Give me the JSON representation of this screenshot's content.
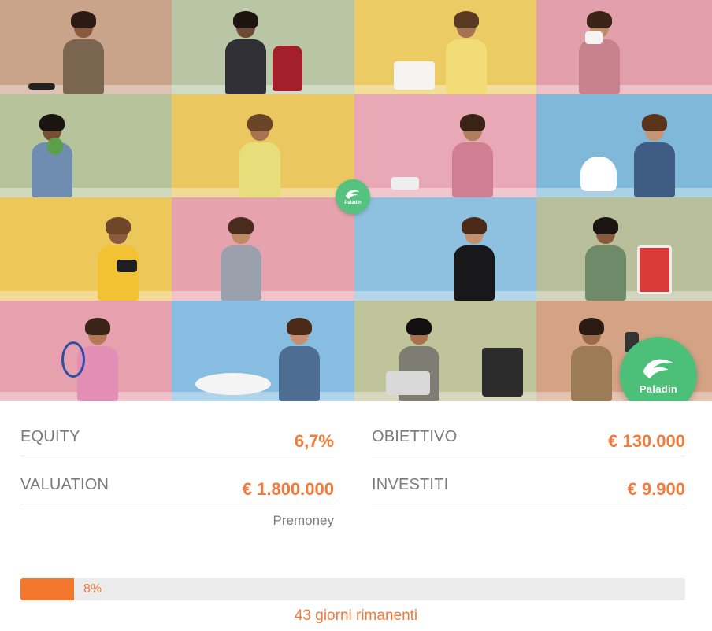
{
  "brand": {
    "badge_label": "Paladin",
    "badge_small_label": "Paladin",
    "accent_color": "#f27a3a",
    "brand_color": "#4cbf79"
  },
  "collage": {
    "tiles": [
      {
        "bg": "#c9a48b",
        "shirt": "#7a6650",
        "prop": "vr-headset"
      },
      {
        "bg": "#b9c6a6",
        "shirt": "#2f2f35",
        "prop": "stand-mixer"
      },
      {
        "bg": "#eccb65",
        "shirt": "#f1dc78",
        "prop": "sewing-machine"
      },
      {
        "bg": "#e2a0ac",
        "shirt": "#c7828d",
        "prop": "instant-camera"
      },
      {
        "bg": "#b7c49b",
        "shirt": "#6f8db0",
        "prop": "gadget"
      },
      {
        "bg": "#eac75f",
        "shirt": "#e7dd7a",
        "prop": "dance"
      },
      {
        "bg": "#e8a8b6",
        "shirt": "#d07f92",
        "prop": "projector"
      },
      {
        "bg": "#7fb8d8",
        "shirt": "#3f5d84",
        "prop": "smart-garden"
      },
      {
        "bg": "#ecc759",
        "shirt": "#f2c234",
        "prop": "bag"
      },
      {
        "bg": "#e6a3ad",
        "shirt": "#9aa0ac",
        "prop": "dress"
      },
      {
        "bg": "#8ec1df",
        "shirt": "#18181b",
        "prop": "tuxedo"
      },
      {
        "bg": "#b9bf9a",
        "shirt": "#6f8a68",
        "prop": "popcorn-machine"
      },
      {
        "bg": "#e7a0ae",
        "shirt": "#e28eb5",
        "prop": "tennis-racket"
      },
      {
        "bg": "#86bde0",
        "shirt": "#4e6d92",
        "prop": "pillow"
      },
      {
        "bg": "#c0c49a",
        "shirt": "#7d7d74",
        "prop": "dj-setup"
      },
      {
        "bg": "#d4a285",
        "shirt": "#9c7b57",
        "prop": "drill"
      }
    ]
  },
  "stats": {
    "equity_label": "EQUITY",
    "equity_value": "6,7%",
    "objective_label": "OBIETTIVO",
    "objective_value": "€ 130.000",
    "valuation_label": "VALUATION",
    "valuation_value": "€ 1.800.000",
    "valuation_note": "Premoney",
    "invested_label": "INVESTITI",
    "invested_value": "€ 9.900"
  },
  "progress": {
    "percent_label": "8%",
    "fraction": 0.08
  },
  "remaining_label": "43 giorni rimanenti"
}
